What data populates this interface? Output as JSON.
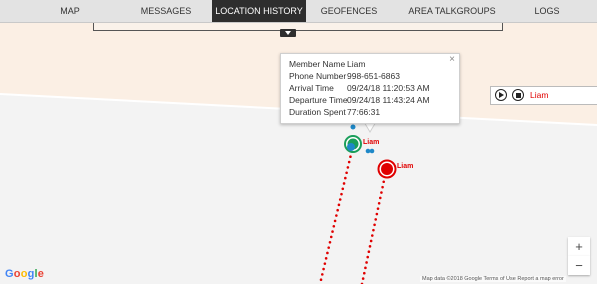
{
  "nav": {
    "tabs": [
      {
        "label": "MAP"
      },
      {
        "label": "MESSAGES"
      },
      {
        "label": "LOCATION HISTORY"
      },
      {
        "label": "GEOFENCES"
      },
      {
        "label": "AREA TALKGROUPS"
      },
      {
        "label": "LOGS"
      }
    ],
    "active_tab": "LOCATION HISTORY"
  },
  "popup": {
    "rows": [
      {
        "key": "Member Name",
        "value": "Liam"
      },
      {
        "key": "Phone Number",
        "value": "998-651-6863"
      },
      {
        "key": "Arrival Time",
        "value": "09/24/18 11:20:53 AM"
      },
      {
        "key": "Departure Time",
        "value": "09/24/18 11:43:24 AM"
      },
      {
        "key": "Duration Spent",
        "value": "77:66:31"
      }
    ],
    "close_symbol": "×"
  },
  "player": {
    "member_name": "Liam"
  },
  "markers": [
    {
      "label": "Liam",
      "color": "#e00000"
    },
    {
      "label": "Liam",
      "color": "#e00000"
    }
  ],
  "zoom": {
    "in_label": "+",
    "out_label": "−"
  },
  "map": {
    "logo_letters": [
      "G",
      "o",
      "o",
      "g",
      "l",
      "e"
    ],
    "attribution": "Map data ©2018 Google   Terms of Use   Report a map error"
  },
  "colors": {
    "accent_active_tab": "#2e2e2e",
    "route_red": "#e00000",
    "marker_green": "#1a9e5a",
    "cluster_blue": "#1e88c8"
  }
}
